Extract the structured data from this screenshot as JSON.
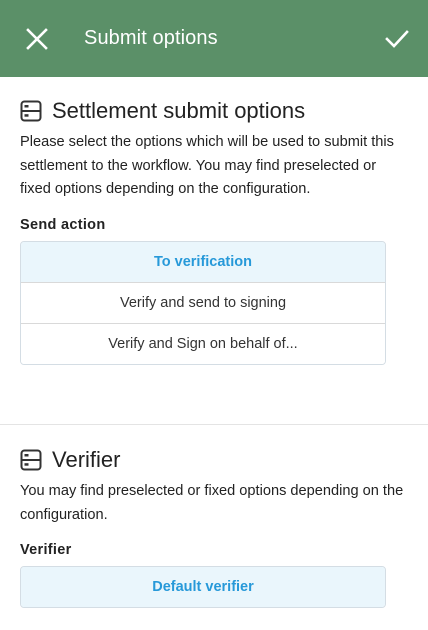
{
  "appbar": {
    "title": "Submit options",
    "close_icon": "close-icon",
    "confirm_icon": "check-icon",
    "background_color": "#5b9068"
  },
  "settlement": {
    "icon": "server-icon",
    "title": "Settlement submit options",
    "description": "Please select the options which will be used to submit this settlement to the workflow. You may find preselected or fixed options depending on the configuration.",
    "field_label": "Send action",
    "options": [
      {
        "label": "To verification",
        "selected": true
      },
      {
        "label": "Verify and send to signing",
        "selected": false
      },
      {
        "label": "Verify and Sign on behalf of...",
        "selected": false
      }
    ]
  },
  "verifier": {
    "icon": "server-icon",
    "title": "Verifier",
    "description": "You may find preselected or fixed options depending on the configuration.",
    "field_label": "Verifier",
    "options": [
      {
        "label": "Default verifier",
        "selected": true
      }
    ]
  },
  "colors": {
    "accent": "#2799d9",
    "selected_background": "#eaf6fc"
  }
}
